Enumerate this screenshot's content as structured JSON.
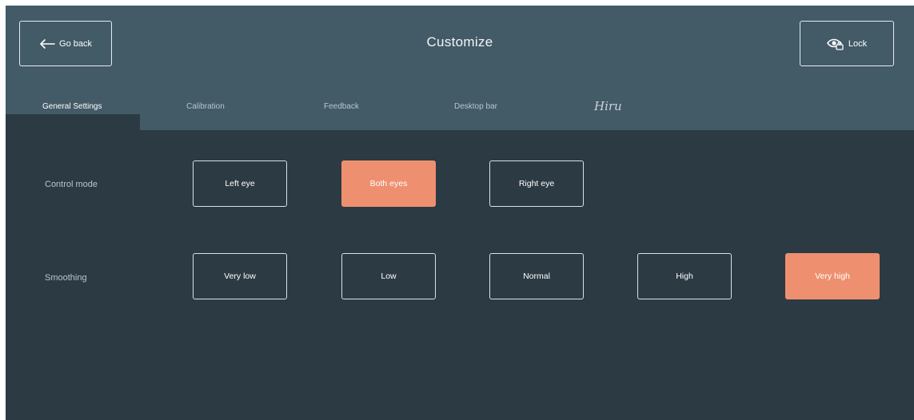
{
  "header": {
    "title": "Customize",
    "back_label": "Go back",
    "lock_label": "Lock",
    "back_icon": "arrow-left-icon",
    "lock_icon": "eye-lock-icon"
  },
  "tabs": [
    {
      "label": "General Settings",
      "active": true
    },
    {
      "label": "Calibration",
      "active": false
    },
    {
      "label": "Feedback",
      "active": false
    },
    {
      "label": "Desktop bar",
      "active": false
    },
    {
      "label": "Hiru",
      "active": false
    }
  ],
  "settings": {
    "control_mode": {
      "label": "Control mode",
      "options": [
        "Left eye",
        "Both eyes",
        "Right eye"
      ],
      "selected": "Both eyes"
    },
    "smoothing": {
      "label": "Smoothing",
      "options": [
        "Very low",
        "Low",
        "Normal",
        "High",
        "Very high"
      ],
      "selected": "Very high"
    }
  },
  "colors": {
    "header_bg": "#435a67",
    "body_bg": "#2c3a44",
    "accent": "#ee9070"
  }
}
